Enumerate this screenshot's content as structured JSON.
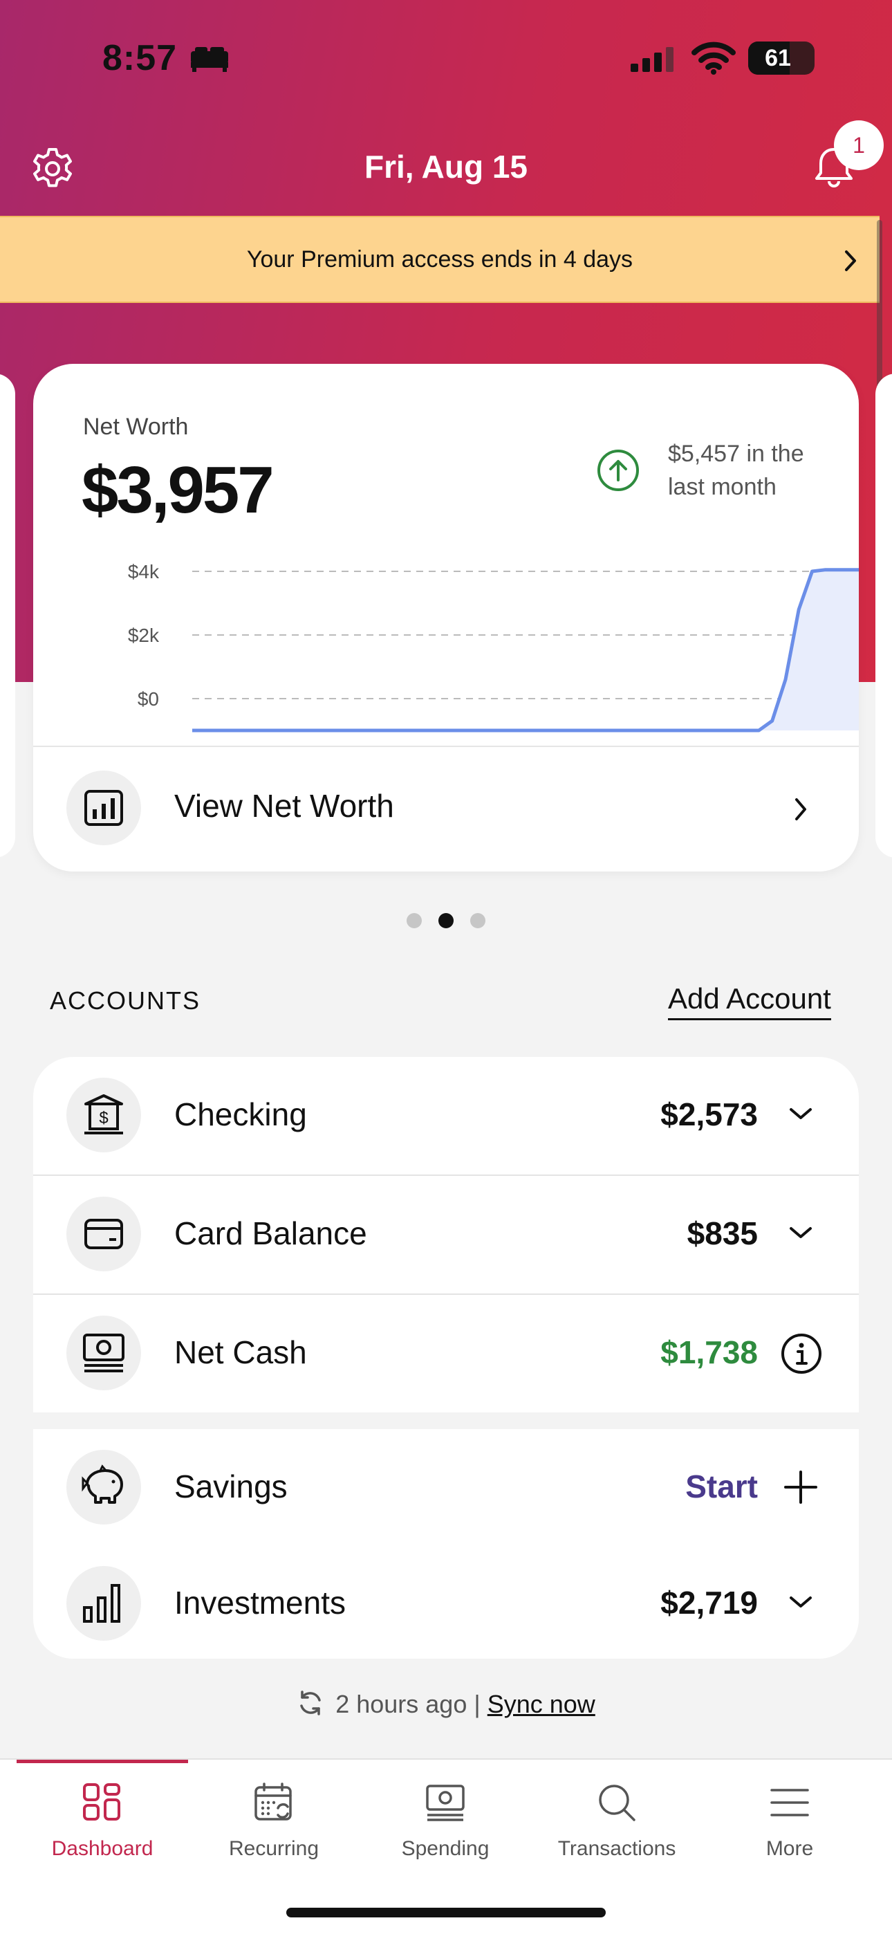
{
  "status_bar": {
    "time": "8:57",
    "battery": "61"
  },
  "header": {
    "date": "Fri, Aug 15",
    "notification_count": "1"
  },
  "premium_banner": {
    "text": "Your Premium access ends in 4 days"
  },
  "net_worth": {
    "label": "Net Worth",
    "value": "$3,957",
    "change_text": "$5,457 in the last month",
    "view_label": "View Net Worth",
    "chart_data": {
      "type": "area",
      "y_ticks": [
        "$4k",
        "$2k",
        "$0"
      ],
      "ylim": [
        -1000,
        4000
      ],
      "grid": true,
      "x": [
        0,
        0.3,
        0.6,
        0.85,
        0.87,
        0.89,
        0.91,
        0.93,
        0.95,
        1.0
      ],
      "y": [
        -1000,
        -1000,
        -1000,
        -1000,
        -700,
        600,
        2800,
        4000,
        4050,
        4050
      ]
    }
  },
  "carousel": {
    "pages": 3,
    "active_index": 1
  },
  "accounts": {
    "section_label": "ACCOUNTS",
    "add_label": "Add Account",
    "items": [
      {
        "label": "Checking",
        "value": "$2,573",
        "icon": "bank-icon",
        "action": "chevron-down-icon",
        "value_color": "#111111"
      },
      {
        "label": "Card Balance",
        "value": "$835",
        "icon": "credit-card-icon",
        "action": "chevron-down-icon",
        "value_color": "#111111"
      },
      {
        "label": "Net Cash",
        "value": "$1,738",
        "icon": "cash-icon",
        "action": "info-icon",
        "value_color": "#2e8b3e"
      },
      {
        "label": "Savings",
        "value": "Start",
        "icon": "piggy-bank-icon",
        "action": "plus-icon",
        "value_color": "#4a3a8c"
      },
      {
        "label": "Investments",
        "value": "$2,719",
        "icon": "bar-chart-icon",
        "action": "chevron-down-icon",
        "value_color": "#111111"
      }
    ]
  },
  "sync": {
    "time_text": "2 hours ago |",
    "link": "Sync now"
  },
  "tabs": [
    {
      "label": "Dashboard",
      "icon": "dashboard-icon",
      "active": true
    },
    {
      "label": "Recurring",
      "icon": "calendar-icon",
      "active": false
    },
    {
      "label": "Spending",
      "icon": "cash-icon",
      "active": false
    },
    {
      "label": "Transactions",
      "icon": "search-icon",
      "active": false
    },
    {
      "label": "More",
      "icon": "menu-icon",
      "active": false
    }
  ],
  "colors": {
    "brand": "#c2274e",
    "positive": "#2e8b3e",
    "accent_purple": "#4a3a8c",
    "chart_line": "#6b8ee8",
    "banner": "#fdd48f"
  }
}
